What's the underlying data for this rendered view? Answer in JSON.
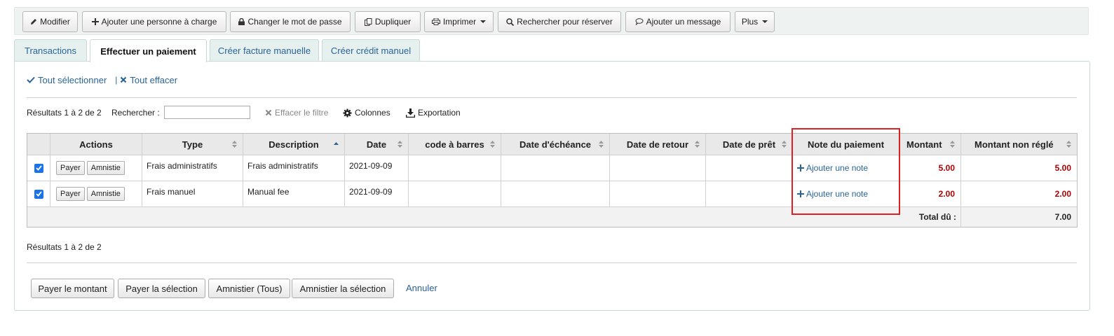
{
  "toolbar": {
    "modify": "Modifier",
    "add_dependent": "Ajouter une personne à charge",
    "change_password": "Changer le mot de passe",
    "duplicate": "Dupliquer",
    "print": "Imprimer",
    "search_to_hold": "Rechercher pour réserver",
    "add_message": "Ajouter un message",
    "more": "Plus"
  },
  "tabs": [
    {
      "label": "Transactions"
    },
    {
      "label": "Effectuer un paiement"
    },
    {
      "label": "Créer facture manuelle"
    },
    {
      "label": "Créer crédit manuel"
    }
  ],
  "selection": {
    "select_all": "Tout sélectionner",
    "separator": "|",
    "clear_all": "Tout effacer"
  },
  "filter": {
    "results_top": "Résultats 1 à 2 de 2",
    "search_label": "Rechercher :",
    "search_value": "",
    "clear_filter": "Effacer le filtre",
    "columns": "Colonnes",
    "export": "Exportation"
  },
  "table": {
    "headers": [
      "Actions",
      "Type",
      "Description",
      "Date",
      "code à barres",
      "Date d'échéance",
      "Date de retour",
      "Date de prêt",
      "Note du paiement",
      "Montant",
      "Montant non réglé"
    ],
    "pay_label": "Payer",
    "writeoff_label": "Amnistie",
    "add_note": "Ajouter une note",
    "rows": [
      {
        "type": "Frais administratifs",
        "description": "Frais administratifs",
        "date": "2021-09-09",
        "barcode": "",
        "due": "",
        "returned": "",
        "issued": "",
        "amount": "5.00",
        "outstanding": "5.00"
      },
      {
        "type": "Frais manuel",
        "description": "Manual fee",
        "date": "2021-09-09",
        "barcode": "",
        "due": "",
        "returned": "",
        "issued": "",
        "amount": "2.00",
        "outstanding": "2.00"
      }
    ],
    "total_label": "Total dû :",
    "total_value": "7.00"
  },
  "results_bottom": "Résultats 1 à 2 de 2",
  "actions": {
    "pay_amount": "Payer le montant",
    "pay_selected": "Payer la sélection",
    "writeoff_all": "Amnistier (Tous)",
    "writeoff_selected": "Amnistier la sélection",
    "cancel": "Annuler"
  },
  "colors": {
    "link": "#2a6496",
    "amount": "#b00000",
    "highlight": "#e02020",
    "checkbox": "#1a73e8"
  }
}
